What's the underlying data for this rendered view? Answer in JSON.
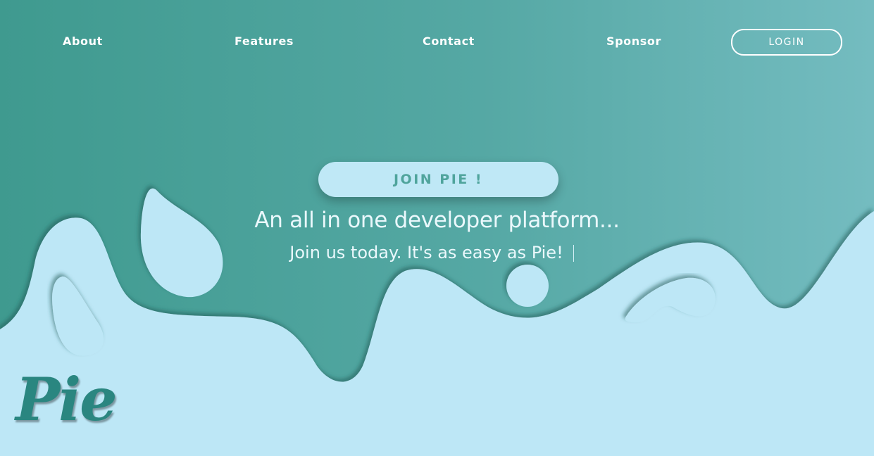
{
  "nav": {
    "about": "About",
    "features": "Features",
    "contact": "Contact",
    "sponsor": "Sponsor",
    "login": "LOGIN"
  },
  "hero": {
    "cta": "JOIN PIE !",
    "title": "An all in one developer platform...",
    "subtitle": "Join us today. It's as easy as Pie!"
  },
  "logo": "Pie",
  "colors": {
    "teal_dark": "#3f9a8f",
    "teal_light": "#74bcc0",
    "sky": "#bde7f6",
    "cta_text": "#4fa49c"
  }
}
